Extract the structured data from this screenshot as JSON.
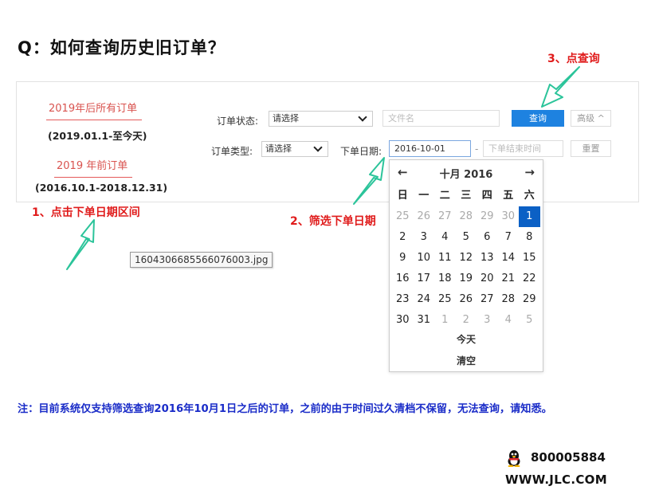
{
  "title": "Q：如何查询历史旧订单？",
  "left_panel": {
    "recent_link": "2019年后所有订单",
    "recent_range": "(2019.01.1-至今天)",
    "old_link": "2019 年前订单",
    "old_range": "(2016.10.1-2018.12.31)"
  },
  "filters": {
    "order_status_label": "订单状态:",
    "order_status_value": "请选择",
    "filename_placeholder": "文件名",
    "search_button": "查询",
    "advanced_button": "高级 ^",
    "order_type_label": "订单类型:",
    "order_type_value": "请选择",
    "order_date_label": "下单日期:",
    "start_date_value": "2016-10-01",
    "date_separator": "-",
    "end_date_placeholder": "下单结束时间",
    "reset_button": "重置"
  },
  "calendar": {
    "prev_icon": "←",
    "next_icon": "→",
    "month_label": "十月 2016",
    "weekdays": [
      "日",
      "一",
      "二",
      "三",
      "四",
      "五",
      "六"
    ],
    "weeks": [
      [
        {
          "d": "25",
          "o": true
        },
        {
          "d": "26",
          "o": true
        },
        {
          "d": "27",
          "o": true
        },
        {
          "d": "28",
          "o": true
        },
        {
          "d": "29",
          "o": true
        },
        {
          "d": "30",
          "o": true
        },
        {
          "d": "1",
          "s": true
        }
      ],
      [
        {
          "d": "2"
        },
        {
          "d": "3"
        },
        {
          "d": "4"
        },
        {
          "d": "5"
        },
        {
          "d": "6"
        },
        {
          "d": "7"
        },
        {
          "d": "8"
        }
      ],
      [
        {
          "d": "9"
        },
        {
          "d": "10"
        },
        {
          "d": "11"
        },
        {
          "d": "12"
        },
        {
          "d": "13"
        },
        {
          "d": "14"
        },
        {
          "d": "15"
        }
      ],
      [
        {
          "d": "16"
        },
        {
          "d": "17"
        },
        {
          "d": "18"
        },
        {
          "d": "19"
        },
        {
          "d": "20"
        },
        {
          "d": "21"
        },
        {
          "d": "22"
        }
      ],
      [
        {
          "d": "23"
        },
        {
          "d": "24"
        },
        {
          "d": "25"
        },
        {
          "d": "26"
        },
        {
          "d": "27"
        },
        {
          "d": "28"
        },
        {
          "d": "29"
        }
      ],
      [
        {
          "d": "30"
        },
        {
          "d": "31"
        },
        {
          "d": "1",
          "o": true
        },
        {
          "d": "2",
          "o": true
        },
        {
          "d": "3",
          "o": true
        },
        {
          "d": "4",
          "o": true
        },
        {
          "d": "5",
          "o": true
        }
      ]
    ],
    "today_button": "今天",
    "clear_button": "清空"
  },
  "annotations": {
    "step1": "1、点击下单日期区间",
    "step2": "2、筛选下单日期",
    "step3": "3、点查询"
  },
  "tooltip": "1604306685566076003.jpg",
  "note": "注：目前系统仅支持筛选查询2016年10月1日之后的订单，之前的由于时间过久清档不保留，无法查询，请知悉。",
  "contact": {
    "qq_number": "800005884",
    "website": "WWW.JLC.COM"
  },
  "colors": {
    "annotation_red": "#e01b1b",
    "arrow_green": "#2bc49a",
    "note_blue": "#1a2cc8",
    "button_blue": "#1e82e0",
    "selected_day": "#0b60c5"
  }
}
